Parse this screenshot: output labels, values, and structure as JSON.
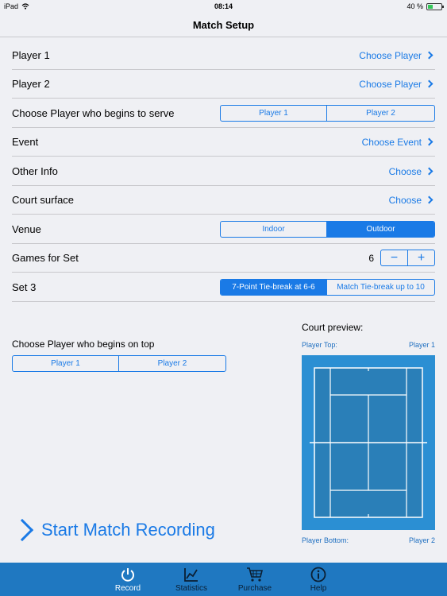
{
  "status": {
    "device": "iPad",
    "time": "08:14",
    "battery": "40 %",
    "battery_level": 0.4
  },
  "nav": {
    "title": "Match Setup"
  },
  "rows": {
    "player1": {
      "label": "Player 1",
      "value": "Choose Player"
    },
    "player2": {
      "label": "Player 2",
      "value": "Choose Player"
    },
    "serve": {
      "label": "Choose Player who begins to serve",
      "options": [
        "Player 1",
        "Player 2"
      ]
    },
    "event": {
      "label": "Event",
      "value": "Choose Event"
    },
    "other": {
      "label": "Other Info",
      "value": "Choose"
    },
    "surface": {
      "label": "Court surface",
      "value": "Choose"
    },
    "venue": {
      "label": "Venue",
      "options": [
        "Indoor",
        "Outdoor"
      ],
      "selected": "Outdoor"
    },
    "games": {
      "label": "Games for Set",
      "value": "6",
      "minus": "−",
      "plus": "+"
    },
    "set3": {
      "label": "Set 3",
      "options": [
        "7-Point Tie-break at 6-6",
        "Match Tie-break up to 10"
      ],
      "selected": "7-Point Tie-break at 6-6"
    }
  },
  "ontop": {
    "label": "Choose Player who begins on top",
    "options": [
      "Player 1",
      "Player 2"
    ]
  },
  "preview": {
    "title": "Court preview:",
    "top_label": "Player Top:",
    "top_value": "Player 1",
    "bottom_label": "Player Bottom:",
    "bottom_value": "Player 2",
    "court_color": "#2b8fd3",
    "court_inner": "#2a7fb8"
  },
  "start": {
    "label": "Start Match Recording"
  },
  "tabs": [
    {
      "label": "Record",
      "icon": "power-icon",
      "active": true
    },
    {
      "label": "Statistics",
      "icon": "chart-icon",
      "active": false
    },
    {
      "label": "Purchase",
      "icon": "cart-icon",
      "active": false
    },
    {
      "label": "Help",
      "icon": "info-icon",
      "active": false
    }
  ],
  "colors": {
    "accent": "#1a7ae6",
    "tabbar": "#1f78c1",
    "background": "#eff0f4"
  }
}
